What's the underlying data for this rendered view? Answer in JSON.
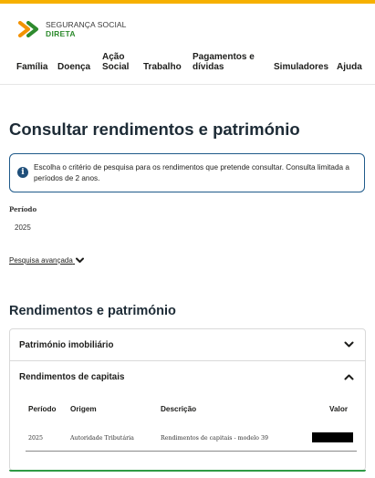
{
  "brand": {
    "line1": "SEGURANÇA SOCIAL",
    "line2": "DIRETA",
    "colors": {
      "accent_bar": "#f6b000",
      "logo_green": "#2e8b2e",
      "logo_orange": "#f39200",
      "info_border": "#1f5a8a",
      "active_border": "#2f9a45"
    }
  },
  "nav": {
    "items": [
      {
        "label": "Família"
      },
      {
        "label": "Doença"
      },
      {
        "label": "Ação Social"
      },
      {
        "label": "Trabalho"
      },
      {
        "label": "Pagamentos e dívidas"
      },
      {
        "label": "Simuladores"
      },
      {
        "label": "Ajuda"
      }
    ]
  },
  "page": {
    "title": "Consultar rendimentos e património",
    "info": {
      "icon": "info-icon",
      "text": "Escolha o critério de pesquisa para os rendimentos que pretende consultar. Consulta limitada a períodos de 2 anos."
    },
    "period": {
      "label": "Período",
      "value": "2025"
    },
    "advanced_search": {
      "label": "Pesquisa avançada",
      "icon": "chevron-down-icon"
    }
  },
  "results": {
    "title": "Rendimentos e património",
    "sections": [
      {
        "label": "Património imobiliário",
        "state": "collapsed",
        "icon": "chevron-down-icon"
      },
      {
        "label": "Rendimentos de capitais",
        "state": "expanded",
        "icon": "chevron-up-icon"
      }
    ],
    "table": {
      "headers": [
        "Período",
        "Origem",
        "Descrição",
        "Valor"
      ],
      "rows": [
        {
          "periodo": "2025",
          "origem": "Autoridade Tributária",
          "descricao": "Rendimentos de capitais - modelo 39",
          "valor": ""
        }
      ]
    }
  }
}
